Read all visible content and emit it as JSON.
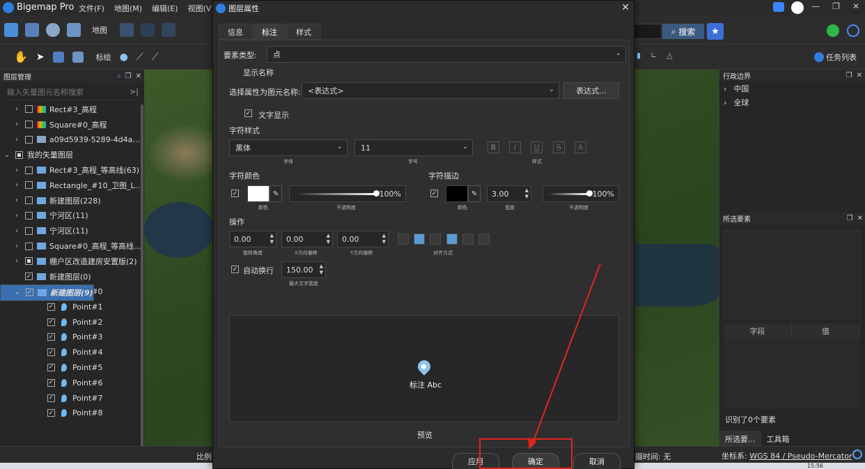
{
  "titlebar": {
    "app_title": "Bigemap Pro",
    "menus": [
      "文件(F)",
      "地图(M)",
      "编辑(E)",
      "视图(V)"
    ],
    "win_controls": [
      "—",
      "❐",
      "✕"
    ]
  },
  "toolbar": {
    "map_label": "地图",
    "draw_label": "标绘",
    "search_label": "搜索",
    "tasklist_label": "任务列表"
  },
  "layer_panel": {
    "title": "图层管理",
    "search_placeholder": "输入矢量图元名称搜索",
    "items": [
      {
        "label": "Rect#3_高程",
        "indent": 1,
        "arrow": "›",
        "checked": false,
        "icon": "raster-icon"
      },
      {
        "label": "Square#0_高程",
        "indent": 1,
        "arrow": "›",
        "checked": false,
        "icon": "raster-icon"
      },
      {
        "label": "a09d5939-5289-4d4a...",
        "indent": 1,
        "arrow": "›",
        "checked": false,
        "icon": "image-icon"
      },
      {
        "label": "我的矢量图层",
        "indent": 0,
        "arrow": "⌄",
        "checked": "partial",
        "icon": ""
      },
      {
        "label": "Rect#3_高程_等高线(63)",
        "indent": 1,
        "arrow": "›",
        "checked": false,
        "icon": "layers-icon"
      },
      {
        "label": "Rectangle_#10_卫图_L...",
        "indent": 1,
        "arrow": "›",
        "checked": false,
        "icon": "layers-icon"
      },
      {
        "label": "新建图层(228)",
        "indent": 1,
        "arrow": "›",
        "checked": false,
        "icon": "layers-icon"
      },
      {
        "label": "宁河区(11)",
        "indent": 1,
        "arrow": "›",
        "checked": false,
        "icon": "layers-icon"
      },
      {
        "label": "宁河区(11)",
        "indent": 1,
        "arrow": "›",
        "checked": false,
        "icon": "layers-icon"
      },
      {
        "label": "Square#0_高程_等高线...",
        "indent": 1,
        "arrow": "›",
        "checked": false,
        "icon": "layers-icon"
      },
      {
        "label": "棚户区改造建房安置版(2)",
        "indent": 1,
        "arrow": "›",
        "checked": "partial",
        "icon": "layers-icon"
      },
      {
        "label": "新建图层(0)",
        "indent": 1,
        "arrow": "",
        "checked": true,
        "icon": "layers-icon"
      },
      {
        "label": "新建图层(9)",
        "indent": 1,
        "arrow": "⌄",
        "checked": true,
        "icon": "layers-icon",
        "selected": true
      },
      {
        "label": "Point#0",
        "indent": 2,
        "arrow": "",
        "checked": true,
        "icon": "point-icon"
      },
      {
        "label": "Point#1",
        "indent": 2,
        "arrow": "",
        "checked": true,
        "icon": "point-icon"
      },
      {
        "label": "Point#2",
        "indent": 2,
        "arrow": "",
        "checked": true,
        "icon": "point-icon"
      },
      {
        "label": "Point#3",
        "indent": 2,
        "arrow": "",
        "checked": true,
        "icon": "point-icon"
      },
      {
        "label": "Point#4",
        "indent": 2,
        "arrow": "",
        "checked": true,
        "icon": "point-icon"
      },
      {
        "label": "Point#5",
        "indent": 2,
        "arrow": "",
        "checked": true,
        "icon": "point-icon"
      },
      {
        "label": "Point#6",
        "indent": 2,
        "arrow": "",
        "checked": true,
        "icon": "point-icon"
      },
      {
        "label": "Point#7",
        "indent": 2,
        "arrow": "",
        "checked": true,
        "icon": "point-icon"
      },
      {
        "label": "Point#8",
        "indent": 2,
        "arrow": "",
        "checked": true,
        "icon": "point-icon"
      }
    ]
  },
  "admin_panel": {
    "title": "行政边界",
    "items": [
      "中国",
      "全球"
    ]
  },
  "selection_panel": {
    "title": "所选要素",
    "col_field": "字段",
    "col_value": "值",
    "identified": "识别了0个要素",
    "tabs": [
      "所选要...",
      "工具箱"
    ]
  },
  "statusbar": {
    "scale_label": "比例",
    "capture_time": "摄时间: 无",
    "crs_label": "坐标系: ",
    "crs_value": "WGS 84 / Pseudo-Mercator",
    "clock": "15:56"
  },
  "dialog": {
    "title": "图层属性",
    "close": "✕",
    "tabs": [
      "信息",
      "标注",
      "样式"
    ],
    "active_tab": 1,
    "feature_type_label": "要素类型:",
    "feature_type_value": "点",
    "display_name_label": "显示名称",
    "attr_select_label": "选择属性为图元名称:",
    "attr_select_value": "<表达式>",
    "expr_button": "表达式...",
    "text_display_label": "文字显示",
    "char_style_label": "字符样式",
    "font_value": "黑体",
    "font_sub": "字体",
    "size_value": "11",
    "size_sub": "字号",
    "format_buttons": [
      "B",
      "I",
      "U",
      "S",
      "A"
    ],
    "style_sub": "样式",
    "char_color_label": "字符颜色",
    "char_outline_label": "字符描边",
    "color_sub": "颜色",
    "opacity_sub": "不透明度",
    "fill_opacity": "100%",
    "fill_opacity_value": 100,
    "outline_width": "3.00",
    "width_sub": "宽度",
    "outline_opacity": "100%",
    "outline_opacity_value": 100,
    "fill_color": "#ffffff",
    "outline_color": "#000000",
    "operation_label": "操作",
    "rotation": "0.00",
    "rotation_sub": "旋转角度",
    "x_offset": "0.00",
    "x_offset_sub": "X方向偏移",
    "y_offset": "0.00",
    "y_offset_sub": "Y方向偏移",
    "align_sub": "对齐方式",
    "wrap_label": "自动换行",
    "wrap_width": "150.00",
    "wrap_sub": "最大文字宽度",
    "preview_text": "标注 Abc",
    "preview_label": "预览",
    "apply_button": "应用",
    "ok_button": "确定",
    "cancel_button": "取消"
  },
  "colors": {
    "accent_blue": "#3a6fb0",
    "annotation_red": "#e3241f"
  }
}
